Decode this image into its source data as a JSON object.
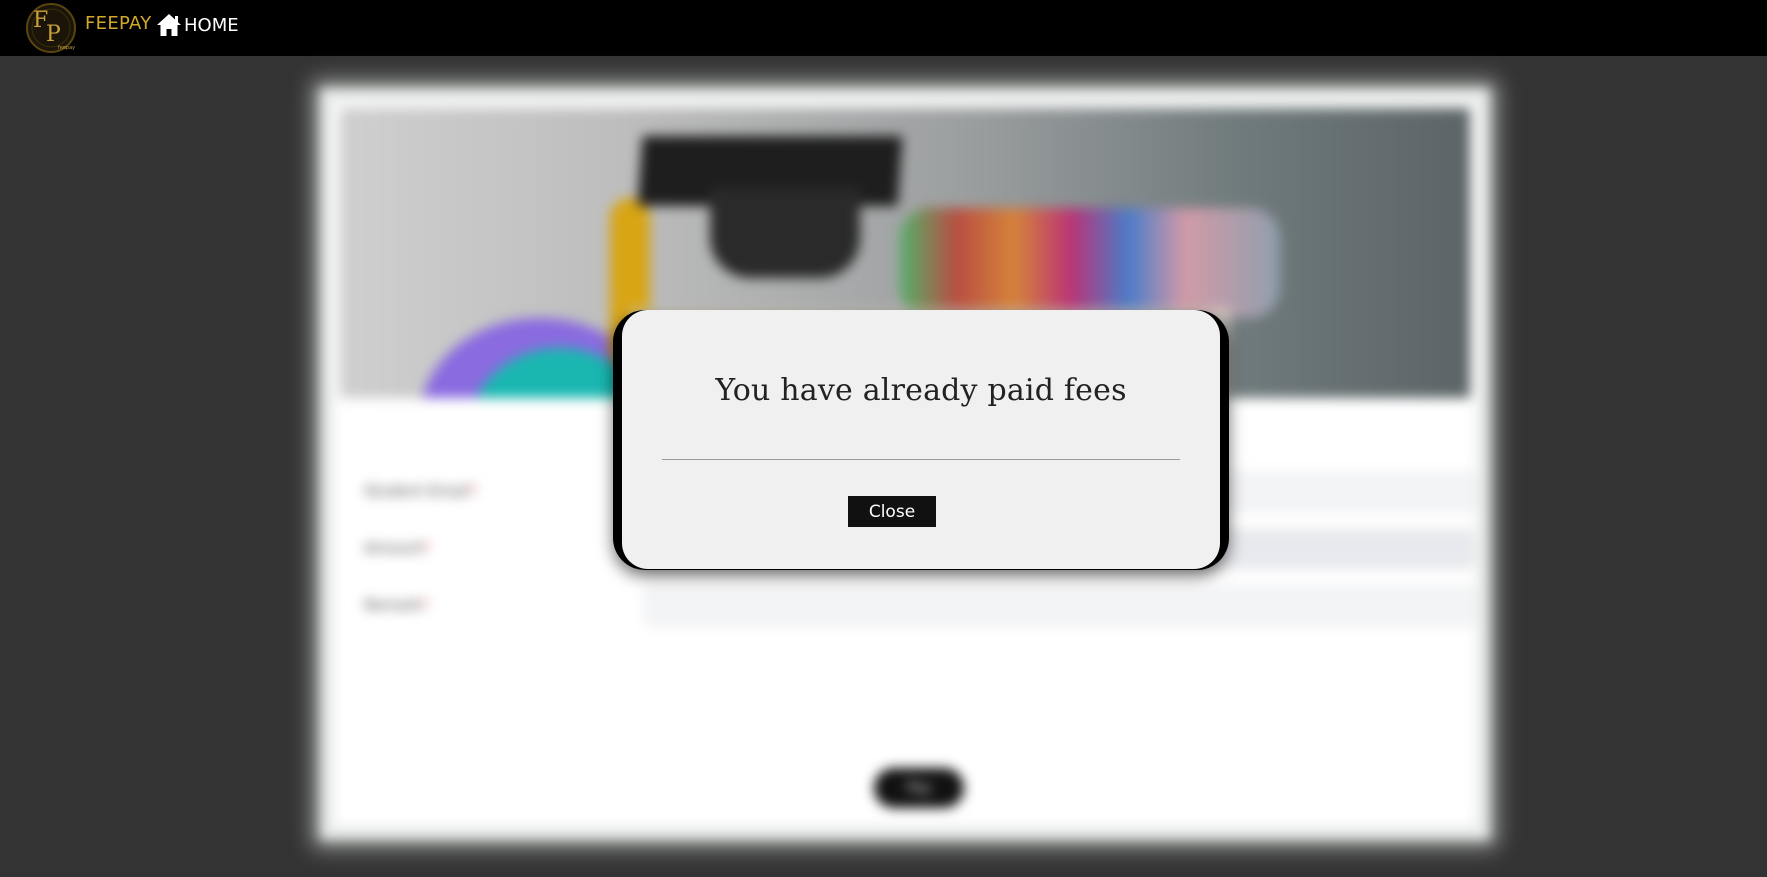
{
  "navbar": {
    "brand": "FEEPAY",
    "home_label": "HOME",
    "logo_text": "FP",
    "logo_subtext": "feepay",
    "brand_color": "#d4a82a"
  },
  "form": {
    "fields": [
      {
        "label": "Student Email",
        "required_mark": "*",
        "placeholder": ""
      },
      {
        "label": "Amount",
        "required_mark": "*",
        "placeholder": ""
      },
      {
        "label": "Remark",
        "required_mark": "*",
        "placeholder": ""
      }
    ],
    "submit_label": "Pay"
  },
  "modal": {
    "title": "You have already paid fees",
    "close_label": "Close"
  },
  "icons": {
    "home": "home-icon",
    "logo": "feepay-logo"
  }
}
